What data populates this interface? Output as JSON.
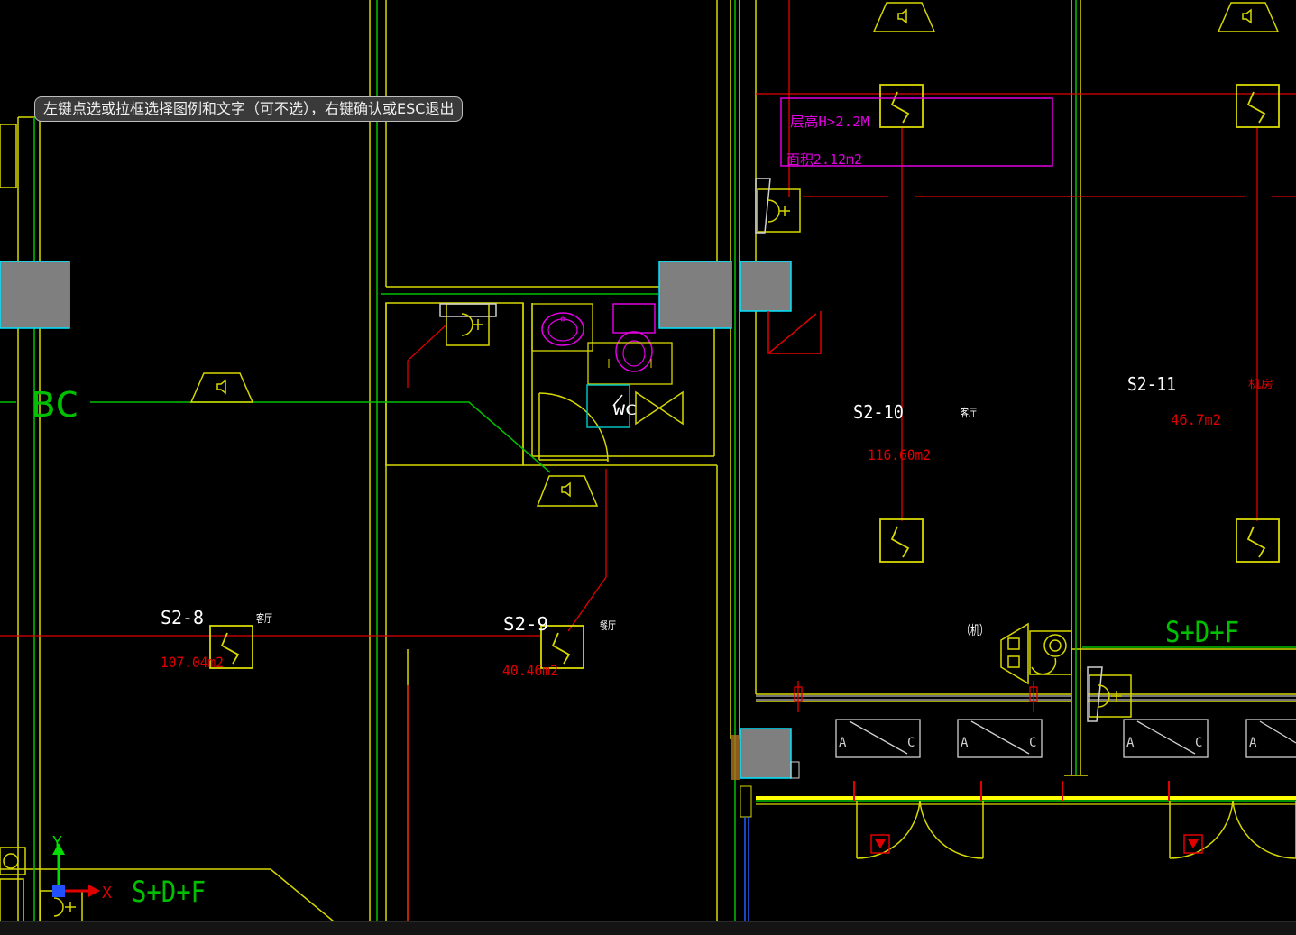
{
  "prompt": {
    "text": "左键点选或拉框选择图例和文字（可不选），右键确认或ESC退出"
  },
  "status": {
    "text": ""
  },
  "colors": {
    "background": "#000000",
    "wall": "#d7d700",
    "axis": "#00c000",
    "wire": "#e00000",
    "annotation": "#e000e0",
    "column": "#7f7f7f",
    "column_edge": "#00e5ff",
    "label": "#ffffff"
  },
  "grid_labels": {
    "bc": "BC",
    "sdf_right": "S+D+F",
    "sdf_ucs": "S+D+F"
  },
  "rooms": [
    {
      "id": "S2-8",
      "area": "107.04m2",
      "tag": "客厅"
    },
    {
      "id": "S2-9",
      "area": "40.46m2",
      "tag": "餐厅"
    },
    {
      "id": "S2-10",
      "area": "116.60m2",
      "tag": "客厅"
    },
    {
      "id": "S2-11",
      "area": "46.7m2",
      "tag": "机房"
    }
  ],
  "annotation_box": {
    "line1": "层高H>2.2M",
    "line2": "面积2.12m2"
  },
  "fixture_labels": {
    "wc": "WC",
    "bracket": "（机）"
  },
  "ucs": {
    "x_label": "X",
    "y_label": "Y"
  },
  "panels": [
    {
      "left": "A",
      "right": "C"
    },
    {
      "left": "A",
      "right": "C"
    },
    {
      "left": "A",
      "right": "C"
    },
    {
      "left": "A",
      "right": ""
    }
  ],
  "icons": [
    "speaker-icon",
    "sensor-s-icon",
    "smoke-detector-icon",
    "door-arc-icon",
    "exit-sign-icon"
  ]
}
